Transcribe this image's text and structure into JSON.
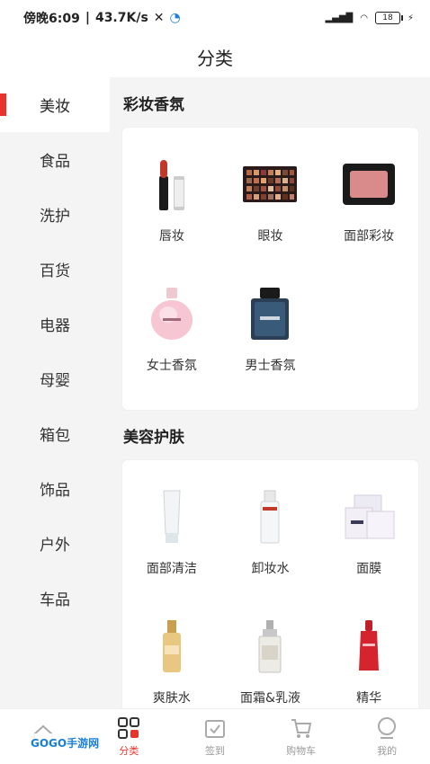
{
  "status_bar": {
    "time": "傍晚6:09",
    "network_speed": "43.7K/s",
    "battery_level": "18"
  },
  "header": {
    "title": "分类"
  },
  "sidebar": {
    "items": [
      {
        "label": "美妆",
        "active": true
      },
      {
        "label": "食品"
      },
      {
        "label": "洗护"
      },
      {
        "label": "百货"
      },
      {
        "label": "电器"
      },
      {
        "label": "母婴"
      },
      {
        "label": "箱包"
      },
      {
        "label": "饰品"
      },
      {
        "label": "户外"
      },
      {
        "label": "车品"
      }
    ]
  },
  "sections": [
    {
      "title": "彩妆香氛",
      "items": [
        {
          "label": "唇妆",
          "icon": "lipstick-icon"
        },
        {
          "label": "眼妆",
          "icon": "eyeshadow-palette-icon"
        },
        {
          "label": "面部彩妆",
          "icon": "blush-compact-icon"
        },
        {
          "label": "女士香氛",
          "icon": "womens-perfume-icon"
        },
        {
          "label": "男士香氛",
          "icon": "mens-perfume-icon"
        }
      ]
    },
    {
      "title": "美容护肤",
      "items": [
        {
          "label": "面部清洁",
          "icon": "cleanser-tube-icon"
        },
        {
          "label": "卸妆水",
          "icon": "makeup-remover-bottle-icon"
        },
        {
          "label": "面膜",
          "icon": "face-mask-pack-icon"
        },
        {
          "label": "爽肤水",
          "icon": "toner-bottle-icon"
        },
        {
          "label": "面霜&乳液",
          "icon": "cream-bottle-icon"
        },
        {
          "label": "精华",
          "icon": "serum-bottle-icon"
        }
      ]
    }
  ],
  "tabbar": {
    "items": [
      {
        "label": "",
        "icon": "home-icon"
      },
      {
        "label": "分类",
        "icon": "category-icon",
        "active": true
      },
      {
        "label": "签到",
        "icon": "checkin-icon"
      },
      {
        "label": "购物车",
        "icon": "cart-icon"
      },
      {
        "label": "我的",
        "icon": "profile-icon"
      }
    ]
  },
  "watermark": "GOGO手游网",
  "colors": {
    "accent": "#e8352c",
    "inactive_tab": "#999999"
  }
}
